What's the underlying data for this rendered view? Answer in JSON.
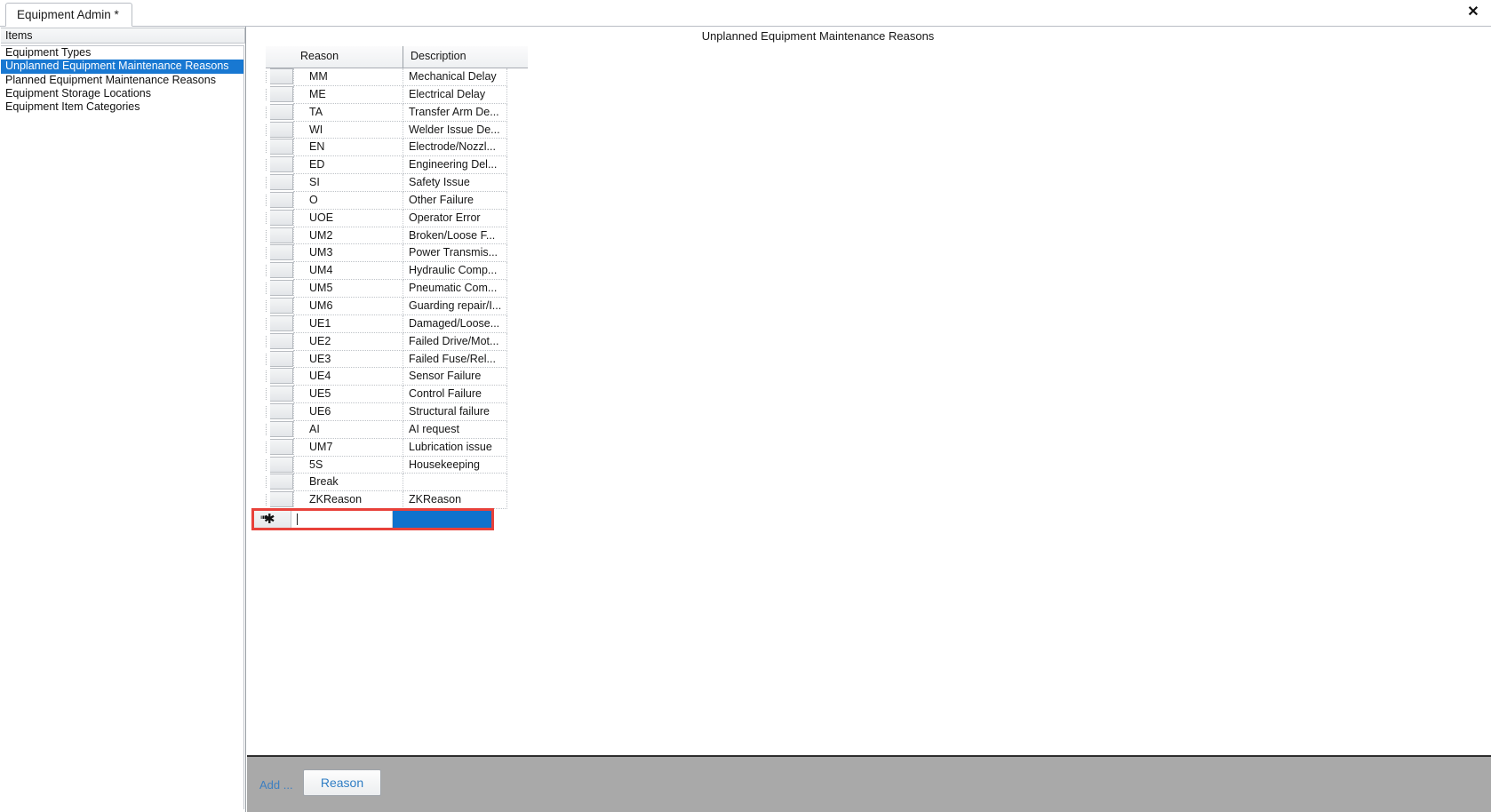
{
  "window": {
    "tab_label": "Equipment Admin *",
    "close_icon": "close-icon"
  },
  "sidebar": {
    "header": "Items",
    "items": [
      {
        "label": "Equipment Types",
        "selected": false
      },
      {
        "label": "Unplanned Equipment Maintenance Reasons",
        "selected": true
      },
      {
        "label": "Planned Equipment Maintenance Reasons",
        "selected": false
      },
      {
        "label": "Equipment Storage Locations",
        "selected": false
      },
      {
        "label": "Equipment Item Categories",
        "selected": false
      }
    ]
  },
  "main": {
    "title": "Unplanned Equipment Maintenance Reasons",
    "grid": {
      "columns": [
        "Reason",
        "Description"
      ],
      "rows": [
        {
          "reason": "MM",
          "description": "Mechanical Delay"
        },
        {
          "reason": "ME",
          "description": "Electrical Delay"
        },
        {
          "reason": "TA",
          "description": "Transfer Arm De..."
        },
        {
          "reason": "WI",
          "description": "Welder Issue De..."
        },
        {
          "reason": "EN",
          "description": "Electrode/Nozzl..."
        },
        {
          "reason": "ED",
          "description": "Engineering Del..."
        },
        {
          "reason": "SI",
          "description": "Safety Issue"
        },
        {
          "reason": "O",
          "description": "Other Failure"
        },
        {
          "reason": "UOE",
          "description": "Operator Error"
        },
        {
          "reason": "UM2",
          "description": "Broken/Loose F..."
        },
        {
          "reason": "UM3",
          "description": "Power Transmis..."
        },
        {
          "reason": "UM4",
          "description": "Hydraulic Comp..."
        },
        {
          "reason": "UM5",
          "description": "Pneumatic Com..."
        },
        {
          "reason": "UM6",
          "description": "Guarding repair/I..."
        },
        {
          "reason": "UE1",
          "description": "Damaged/Loose..."
        },
        {
          "reason": "UE2",
          "description": "Failed Drive/Mot..."
        },
        {
          "reason": "UE3",
          "description": "Failed Fuse/Rel..."
        },
        {
          "reason": "UE4",
          "description": "Sensor Failure"
        },
        {
          "reason": "UE5",
          "description": "Control Failure"
        },
        {
          "reason": "UE6",
          "description": "Structural failure"
        },
        {
          "reason": "AI",
          "description": "AI request"
        },
        {
          "reason": "UM7",
          "description": "Lubrication issue"
        },
        {
          "reason": "5S",
          "description": "Housekeeping"
        },
        {
          "reason": "Break",
          "description": ""
        },
        {
          "reason": "ZKReason",
          "description": "ZKReason"
        }
      ],
      "new_row": {
        "indicator": "new-row-asterisk",
        "reason_value": "",
        "description_value": ""
      }
    }
  },
  "bottom_bar": {
    "add_label": "Add ...",
    "reason_button": "Reason"
  },
  "colors": {
    "selection_blue": "#1878d2",
    "edit_cell_blue": "#0f72cd",
    "new_row_border_red": "#e8413a",
    "link_blue": "#3d7fc1",
    "bottom_bar_gray": "#a9a9a9"
  }
}
